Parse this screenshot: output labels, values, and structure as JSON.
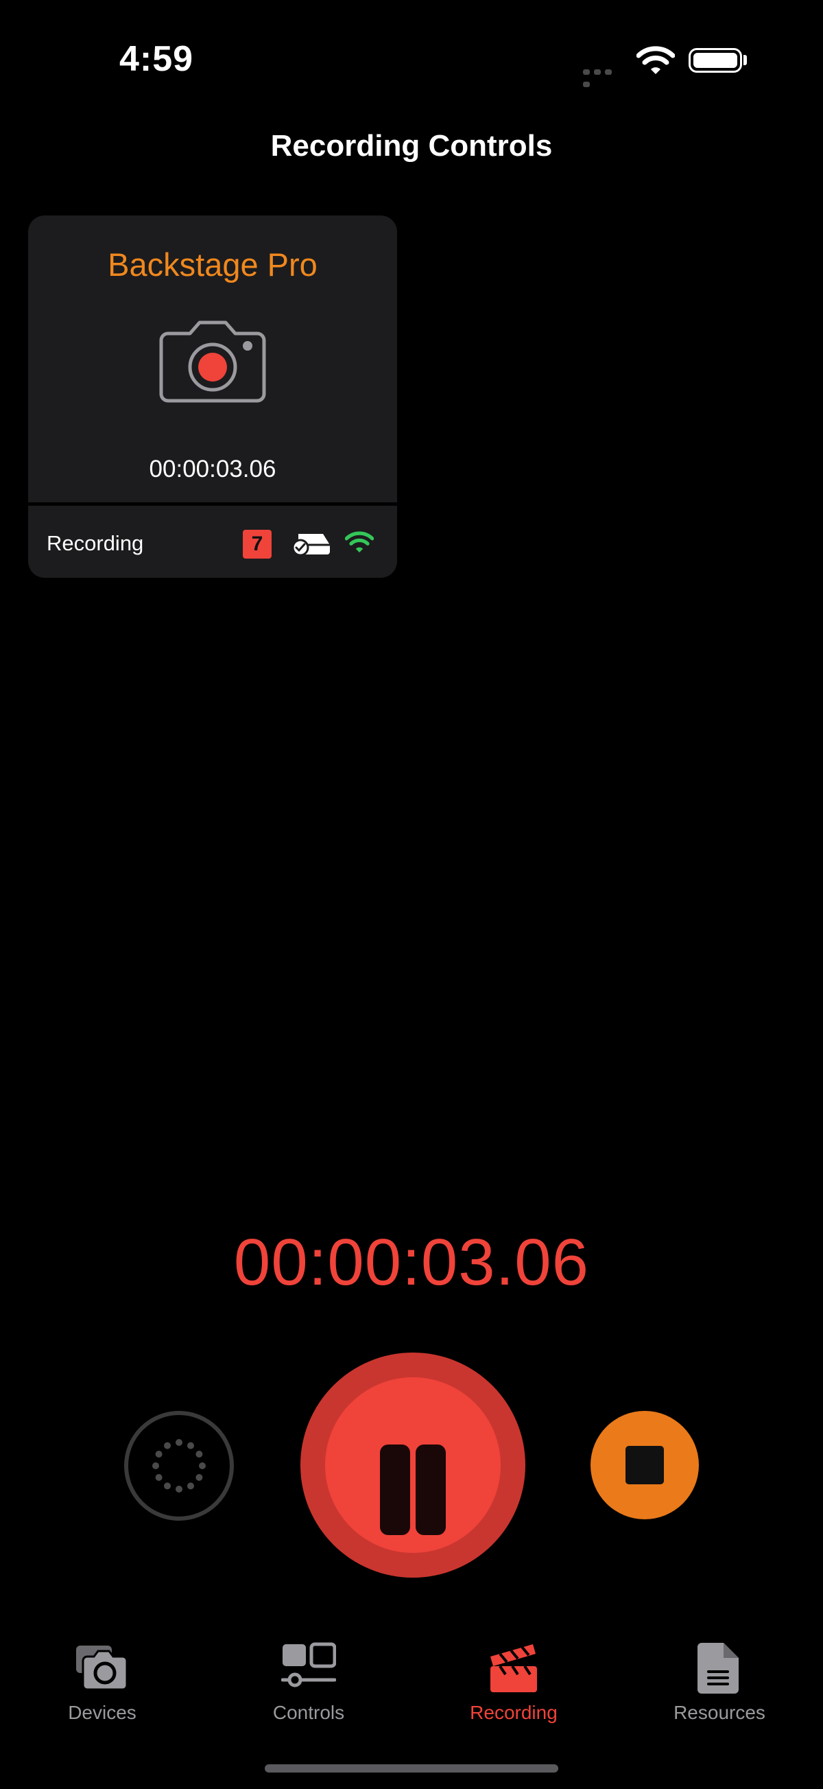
{
  "status_bar": {
    "time": "4:59",
    "icons": [
      "cellular-icon",
      "wifi-icon",
      "battery-icon"
    ]
  },
  "header": {
    "title": "Recording Controls"
  },
  "device_card": {
    "name": "Backstage Pro",
    "icon": "camera-recording-icon",
    "timecode": "00:00:03.06",
    "status": "Recording",
    "badge": "7",
    "status_icons": [
      "media-drive-check-icon",
      "wifi-icon"
    ]
  },
  "main_timecode": "00:00:03.06",
  "controls": {
    "loading": "loading-spinner-icon",
    "pause": "pause-icon",
    "stop": "stop-icon"
  },
  "tab_bar": {
    "items": [
      {
        "label": "Devices",
        "icon": "devices-camera-icon",
        "active": false
      },
      {
        "label": "Controls",
        "icon": "controls-icon",
        "active": false
      },
      {
        "label": "Recording",
        "icon": "clapperboard-icon",
        "active": true
      },
      {
        "label": "Resources",
        "icon": "document-icon",
        "active": false
      }
    ]
  },
  "colors": {
    "accent_red": "#f0433a",
    "accent_orange": "#f0881e",
    "stop_orange": "#ea7a1a",
    "card_bg": "#1c1c1e",
    "wifi_green": "#34c759",
    "inactive_gray": "#9a9a9f"
  }
}
